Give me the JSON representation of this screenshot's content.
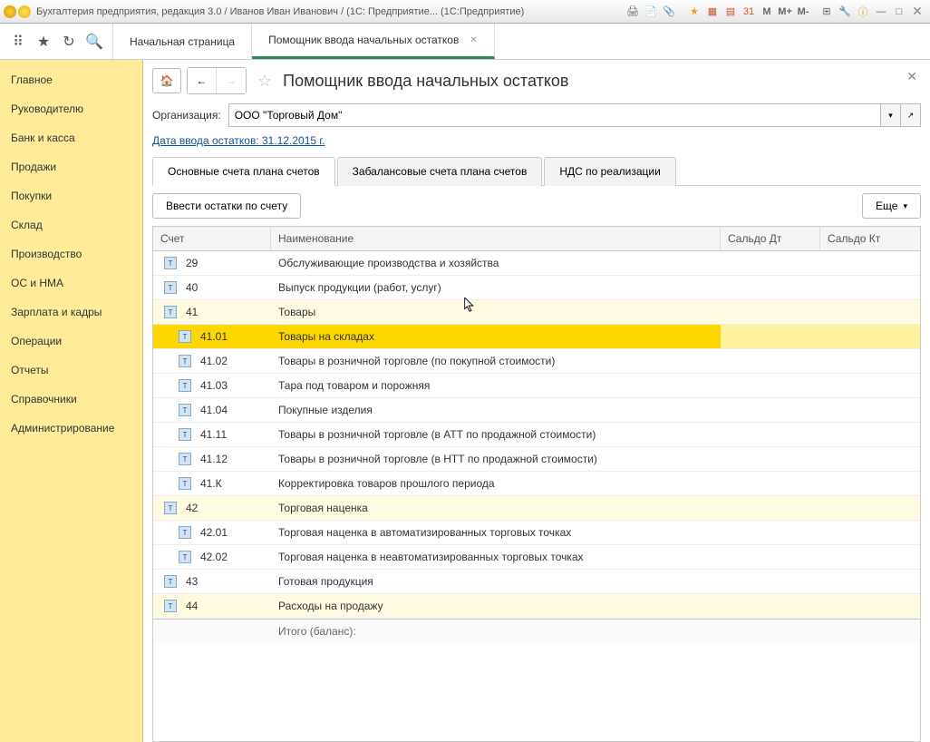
{
  "window": {
    "title": "Бухгалтерия предприятия, редакция 3.0 / Иванов Иван Иванович / (1С: Предприятие...   (1С:Предприятие)"
  },
  "tabs": {
    "home": "Начальная страница",
    "active": "Помощник ввода начальных остатков"
  },
  "sidebar": {
    "items": [
      "Главное",
      "Руководителю",
      "Банк и касса",
      "Продажи",
      "Покупки",
      "Склад",
      "Производство",
      "ОС и НМА",
      "Зарплата и кадры",
      "Операции",
      "Отчеты",
      "Справочники",
      "Администрирование"
    ]
  },
  "page": {
    "title": "Помощник ввода начальных остатков",
    "org_label": "Организация:",
    "org_value": "ООО \"Торговый Дом\"",
    "date_link": "Дата ввода остатков: 31.12.2015 г.",
    "subtabs": {
      "main": "Основные счета плана счетов",
      "offbalance": "Забалансовые счета плана счетов",
      "vat": "НДС по реализации"
    },
    "enter_btn": "Ввести остатки по счету",
    "more_btn": "Еще"
  },
  "table": {
    "headers": {
      "account": "Счет",
      "name": "Наименование",
      "debit": "Сальдо Дт",
      "credit": "Сальдо Кт"
    },
    "rows": [
      {
        "acc": "29",
        "name": "Обслуживающие производства и хозяйства",
        "sub": false,
        "shade": false
      },
      {
        "acc": "40",
        "name": "Выпуск продукции (работ, услуг)",
        "sub": false,
        "shade": false
      },
      {
        "acc": "41",
        "name": "Товары",
        "sub": false,
        "shade": true
      },
      {
        "acc": "41.01",
        "name": "Товары на складах",
        "sub": true,
        "shade": false,
        "selected": true
      },
      {
        "acc": "41.02",
        "name": "Товары в розничной торговле (по покупной стоимости)",
        "sub": true,
        "shade": false
      },
      {
        "acc": "41.03",
        "name": "Тара под товаром и порожняя",
        "sub": true,
        "shade": false
      },
      {
        "acc": "41.04",
        "name": "Покупные изделия",
        "sub": true,
        "shade": false
      },
      {
        "acc": "41.11",
        "name": "Товары в розничной торговле (в АТТ по продажной стоимости)",
        "sub": true,
        "shade": false
      },
      {
        "acc": "41.12",
        "name": "Товары в розничной торговле (в НТТ по продажной стоимости)",
        "sub": true,
        "shade": false
      },
      {
        "acc": "41.К",
        "name": "Корректировка товаров прошлого периода",
        "sub": true,
        "shade": false
      },
      {
        "acc": "42",
        "name": "Торговая наценка",
        "sub": false,
        "shade": true
      },
      {
        "acc": "42.01",
        "name": "Торговая наценка в автоматизированных торговых точках",
        "sub": true,
        "shade": false
      },
      {
        "acc": "42.02",
        "name": "Торговая наценка в неавтоматизированных торговых точках",
        "sub": true,
        "shade": false
      },
      {
        "acc": "43",
        "name": "Готовая продукция",
        "sub": false,
        "shade": false
      },
      {
        "acc": "44",
        "name": "Расходы на продажу",
        "sub": false,
        "shade": true
      }
    ],
    "footer": "Итого (баланс):"
  }
}
